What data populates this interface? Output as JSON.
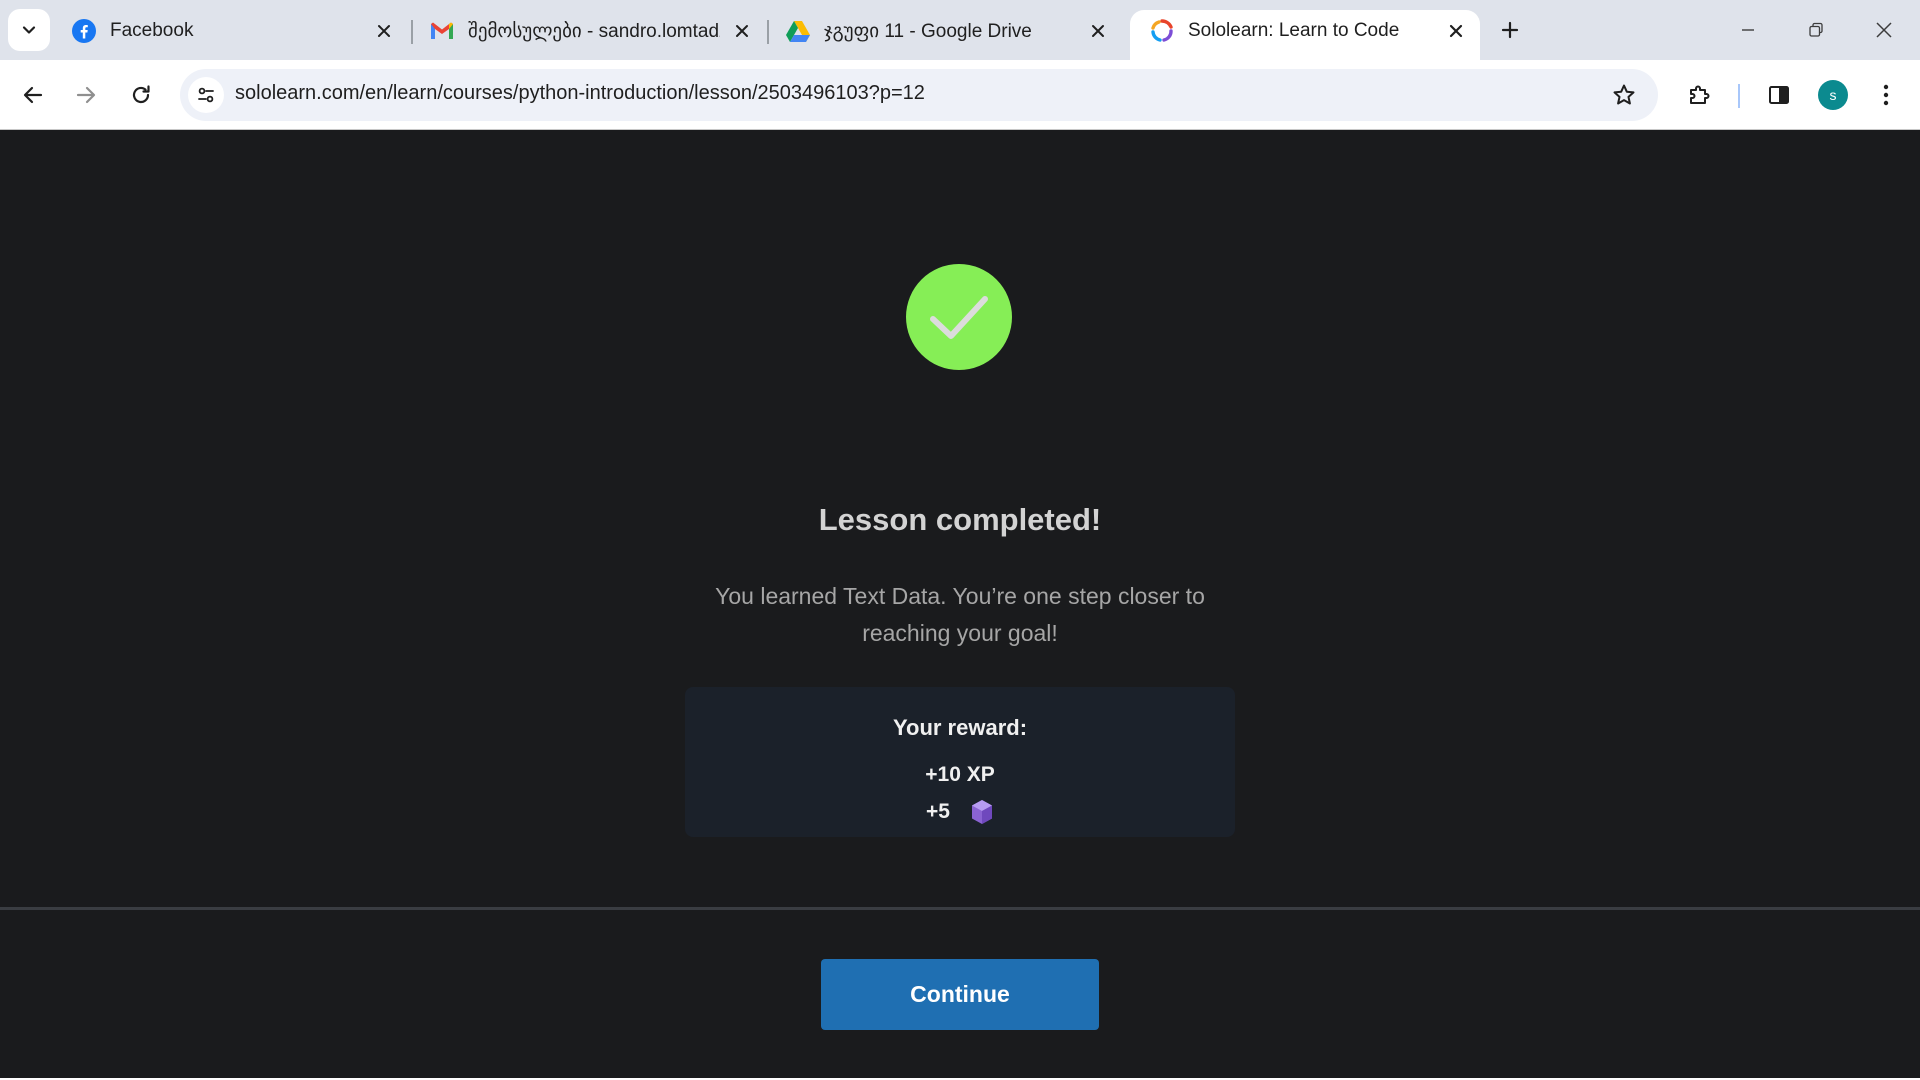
{
  "browser": {
    "tabs": [
      {
        "title": "Facebook",
        "icon": "facebook-icon",
        "active": false
      },
      {
        "title": "შემოსულები - sandro.lomtadze",
        "icon": "gmail-icon",
        "active": false
      },
      {
        "title": "ჯგუფი 11 - Google Drive",
        "icon": "google-drive-icon",
        "active": false
      },
      {
        "title": "Sololearn: Learn to Code",
        "icon": "sololearn-icon",
        "active": true
      }
    ],
    "url": "sololearn.com/en/learn/courses/python-introduction/lesson/2503496103?p=12",
    "avatar_letter": "s",
    "colors": {
      "tabstrip": "#dfe3eb",
      "avatar": "#0b8a8f"
    }
  },
  "lesson": {
    "heading": "Lesson completed!",
    "message": "You learned Text Data. You’re one step closer to reaching your goal!",
    "reward": {
      "title": "Your reward:",
      "xp": "+10 XP",
      "gems": "+5",
      "gem_icon": "gem-icon"
    },
    "continue_label": "Continue",
    "colors": {
      "check": "#86ee56",
      "button": "#1f6fb2",
      "background": "#1a1b1d",
      "card": "#1b212a"
    }
  }
}
